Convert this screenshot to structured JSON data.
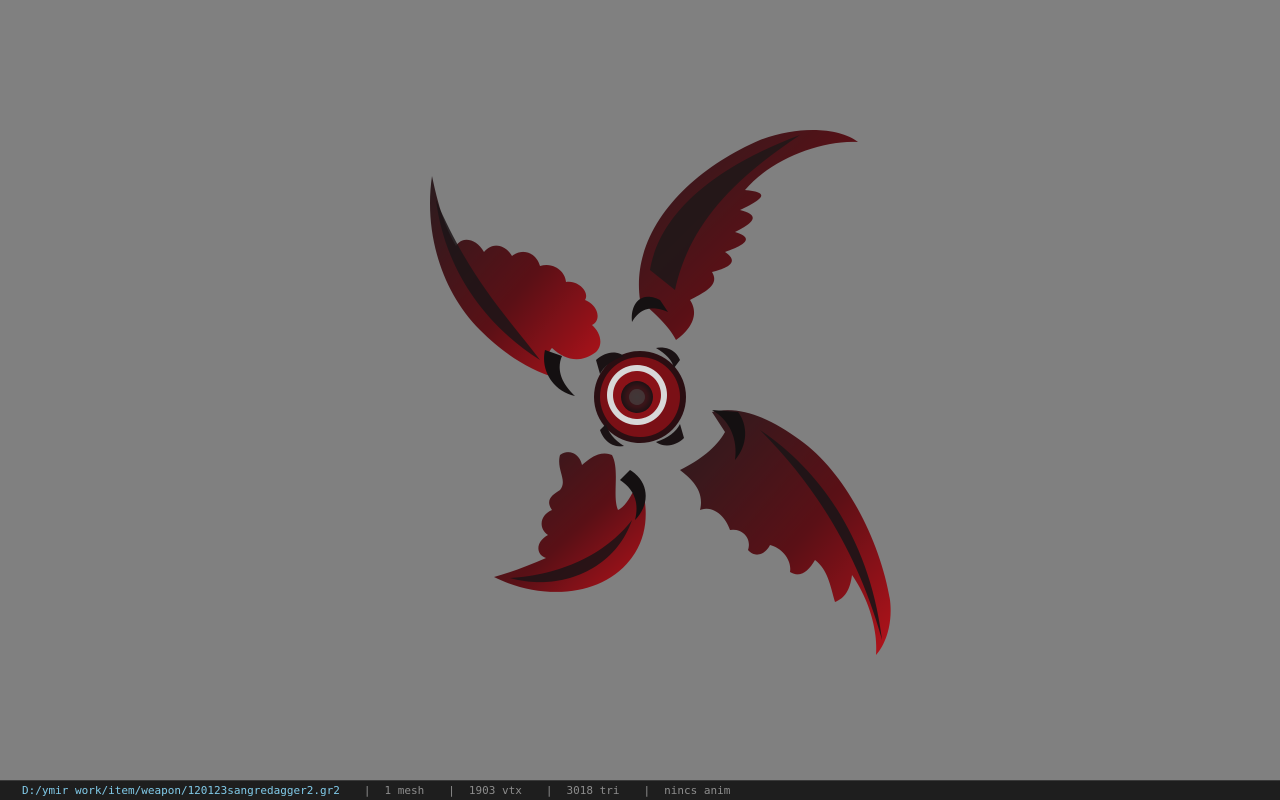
{
  "viewer": {
    "background_color": "#808080",
    "model": {
      "icon": "shuriken-dagger-model",
      "primary_color": "#8b0f14",
      "dark_color": "#1a1416"
    }
  },
  "statusbar": {
    "file_path": "D:/ymir work/item/weapon/120123sangredagger2.gr2",
    "separator": "|",
    "mesh_count": "1 mesh",
    "vertex_count": "1903 vtx",
    "triangle_count": "3018 tri",
    "anim_status": "nincs anim"
  }
}
